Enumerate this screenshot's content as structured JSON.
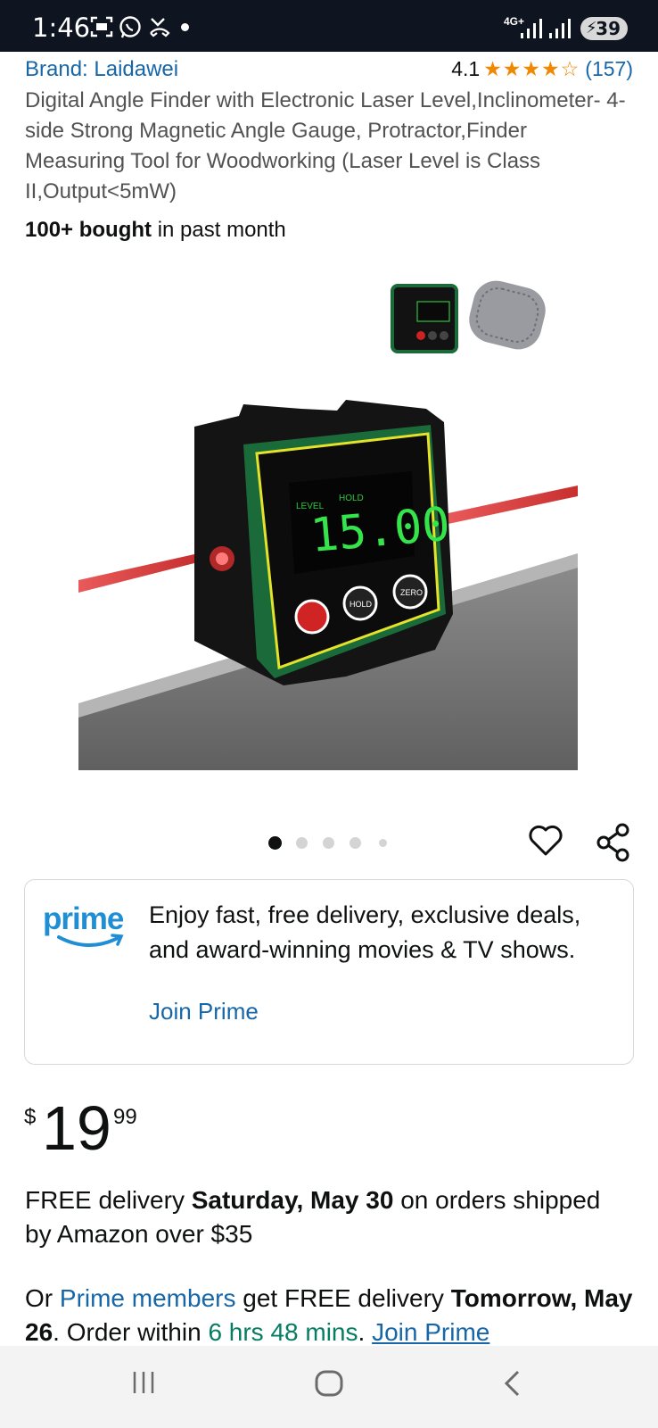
{
  "status_bar": {
    "time": "1:46",
    "network": "4G+",
    "battery": "39"
  },
  "product": {
    "brand": "Brand: Laidawei",
    "rating_value": "4.1",
    "rating_stars": "★★★★☆",
    "rating_count": "(157)",
    "title": "Digital Angle Finder with Electronic Laser Level,Inclinometer- 4-side Strong Magnetic Angle Gauge, Protractor,Finder Measuring Tool for Woodworking (Laser Level is Class II,Output<5mW)",
    "bought_bold": "100+ bought",
    "bought_rest": " in past month",
    "display_reading": "15.00",
    "display_label_level": "LEVEL",
    "display_label_hold": "HOLD",
    "button_hold": "HOLD",
    "button_zero": "ZERO"
  },
  "carousel": {
    "image_count": 5,
    "active_index": 0
  },
  "prime": {
    "logo_text": "prime",
    "description": "Enjoy fast, free delivery, exclusive deals, and award-winning movies & TV shows.",
    "join_label": "Join Prime"
  },
  "price": {
    "currency": "$",
    "whole": "19",
    "fraction": "99"
  },
  "delivery": {
    "line1_prefix": "FREE delivery ",
    "line1_date": "Saturday, May 30",
    "line1_suffix": " on orders shipped by Amazon over $35",
    "line2_prefix": "Or ",
    "line2_link": "Prime members",
    "line2_mid": " get FREE delivery ",
    "line2_date": "Tomorrow, May 26",
    "line2_order": ". Order within ",
    "line2_countdown": "6 hrs 48 mins",
    "line2_period": ". ",
    "line2_join": "Join Prime"
  },
  "colors": {
    "link": "#1767a8",
    "star": "#f08804",
    "green_text": "#067d62",
    "prime_blue": "#1f8ed5"
  }
}
